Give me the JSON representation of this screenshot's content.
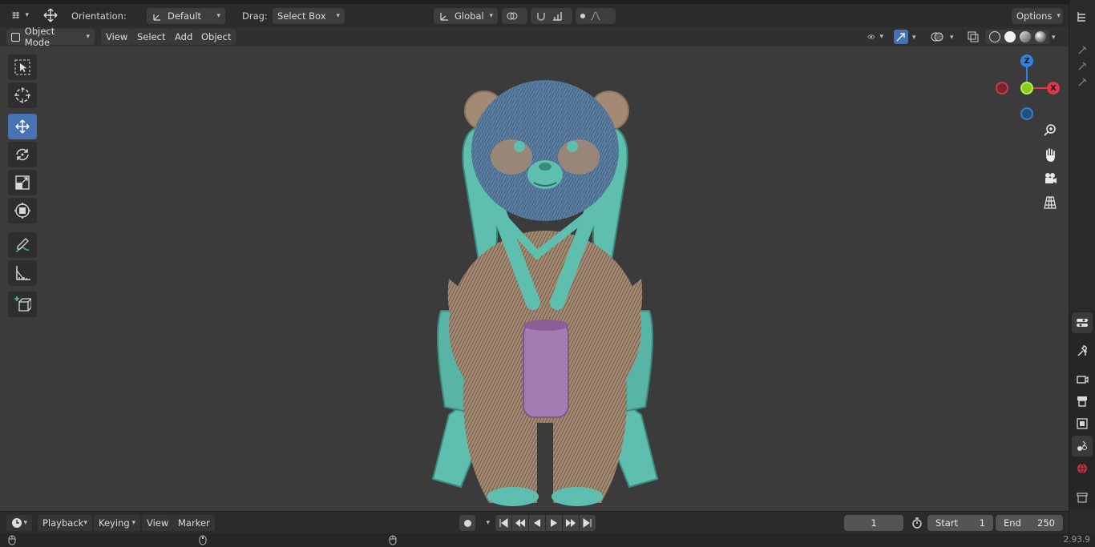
{
  "header": {
    "orientation_label": "Orientation:",
    "orientation_value": "Default",
    "drag_label": "Drag:",
    "drag_value": "Select Box",
    "transform_space": "Global",
    "options_label": "Options"
  },
  "viewport_header": {
    "mode": "Object Mode",
    "menus": [
      "View",
      "Select",
      "Add",
      "Object"
    ]
  },
  "toolbar": {
    "tools": [
      "select-box",
      "cursor",
      "move",
      "rotate",
      "scale",
      "transform",
      "annotate",
      "measure",
      "add-cube"
    ],
    "active_tool": "move"
  },
  "gizmo": {
    "x": "X",
    "y": "Y",
    "z": "Z",
    "colors": {
      "x": "#e4334a",
      "y": "#8bcb1c",
      "z": "#2f83e6"
    }
  },
  "model": {
    "colors": {
      "fur_blue": "#5b7fa3",
      "fur_tan": "#a58a73",
      "seat_teal": "#5fbfae",
      "cup_purple": "#a47bb2"
    }
  },
  "timeline": {
    "menus": [
      "Playback",
      "Keying",
      "View",
      "Marker"
    ],
    "current_frame": "1",
    "start_label": "Start",
    "start_value": "1",
    "end_label": "End",
    "end_value": "250"
  },
  "status": {
    "version": "2.93.9"
  },
  "colors": {
    "accent": "#4772b3",
    "viewport_bg": "#3b3b3b"
  }
}
